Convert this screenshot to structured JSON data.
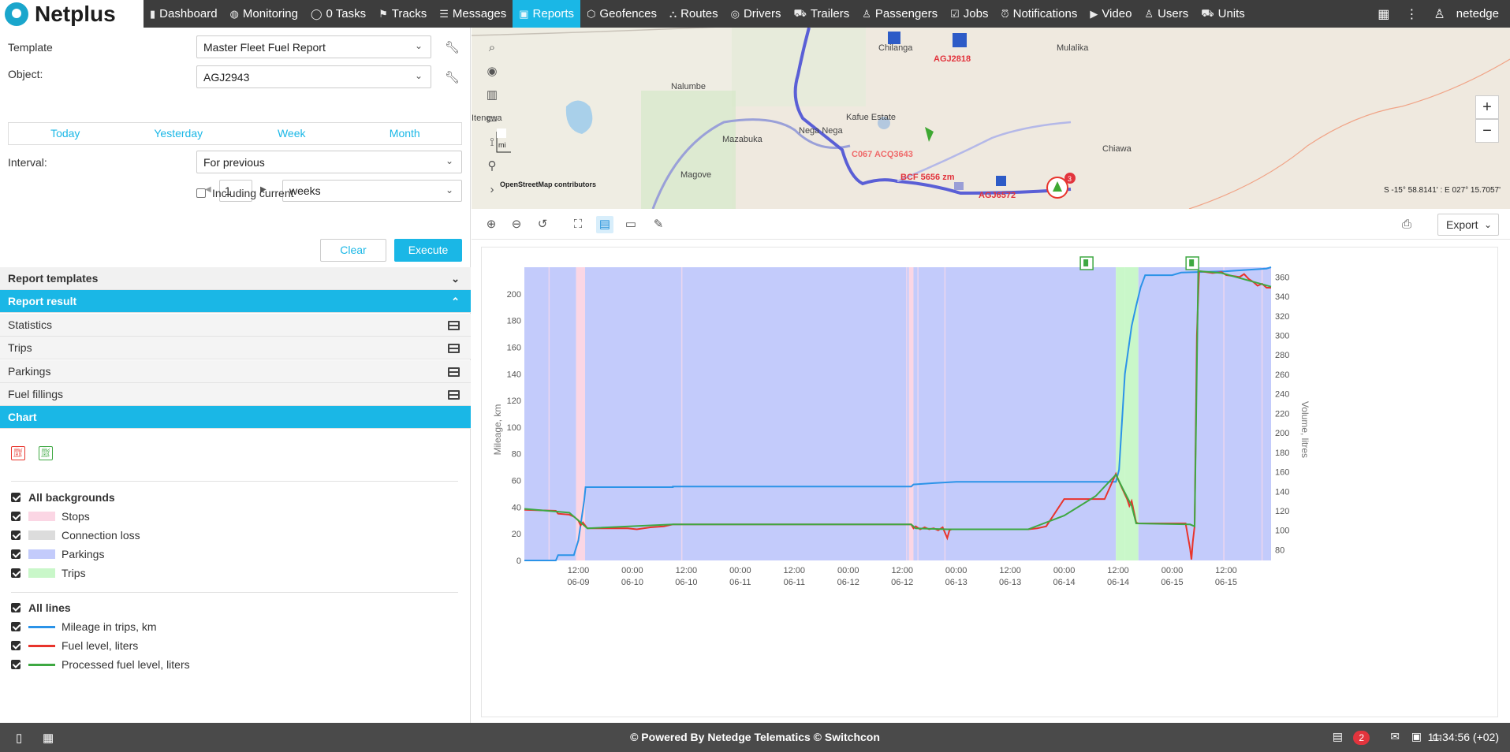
{
  "app": {
    "brand": "Netplus",
    "username": "netedge"
  },
  "nav": [
    {
      "label": "Dashboard",
      "icon": "bar-chart-icon"
    },
    {
      "label": "Monitoring",
      "icon": "globe-icon"
    },
    {
      "label": "0 Tasks",
      "icon": "check-circle-icon"
    },
    {
      "label": "Tracks",
      "icon": "flag-icon"
    },
    {
      "label": "Messages",
      "icon": "list-icon"
    },
    {
      "label": "Reports",
      "icon": "report-icon",
      "active": true
    },
    {
      "label": "Geofences",
      "icon": "geofence-icon"
    },
    {
      "label": "Routes",
      "icon": "route-icon"
    },
    {
      "label": "Drivers",
      "icon": "steering-wheel-icon"
    },
    {
      "label": "Trailers",
      "icon": "trailer-icon"
    },
    {
      "label": "Passengers",
      "icon": "passenger-icon"
    },
    {
      "label": "Jobs",
      "icon": "clipboard-icon"
    },
    {
      "label": "Notifications",
      "icon": "alarm-icon"
    },
    {
      "label": "Video",
      "icon": "video-icon"
    },
    {
      "label": "Users",
      "icon": "user-icon"
    },
    {
      "label": "Units",
      "icon": "car-icon"
    }
  ],
  "form": {
    "template_label": "Template",
    "template_value": "Master Fleet  Fuel Report",
    "object_label": "Object:",
    "object_value": "AGJ2943",
    "quick": [
      "Today",
      "Yesterday",
      "Week",
      "Month"
    ],
    "interval_label": "Interval:",
    "interval_value": "For previous",
    "count_value": "1",
    "unit_value": "weeks",
    "including_current": "Including current",
    "clear_label": "Clear",
    "execute_label": "Execute"
  },
  "sections": {
    "templates": "Report templates",
    "result": "Report result",
    "items": [
      "Statistics",
      "Trips",
      "Parkings",
      "Fuel fillings"
    ],
    "chart": "Chart"
  },
  "legend": {
    "backgrounds_title": "All backgrounds",
    "backgrounds": [
      {
        "label": "Stops",
        "color": "#fbd6e4"
      },
      {
        "label": "Connection loss",
        "color": "#dcdcdc"
      },
      {
        "label": "Parkings",
        "color": "#c3cbfb"
      },
      {
        "label": "Trips",
        "color": "#c9f7c9"
      }
    ],
    "lines_title": "All lines",
    "lines": [
      {
        "label": "Mileage in trips, km",
        "color": "#2b93e8"
      },
      {
        "label": "Fuel level, liters",
        "color": "#e8342c"
      },
      {
        "label": "Processed fuel level, liters",
        "color": "#3ea842"
      }
    ]
  },
  "map": {
    "places": [
      "Chilanga",
      "Mulalika",
      "Nalumbe",
      "Kafue Estate",
      "Nega Nega",
      "Mazabuka",
      "Chiawa",
      "Magove",
      "Itengwa"
    ],
    "units": [
      "AGJ2818",
      "C067 ACQ3643",
      "BCF 5656 zm",
      "AGJ6572"
    ],
    "cluster_count": "3",
    "attribution": "OpenStreetMap contributors",
    "scale_label": "mi",
    "coords": "S -15° 58.8141' : E 027° 15.7057'"
  },
  "toolbar": {
    "export_label": "Export"
  },
  "footer": {
    "powered": "© Powered By Netedge Telematics © Switchcon",
    "time": "11:34:56 (+02)",
    "badge": "2"
  },
  "chart_data": {
    "type": "line",
    "ylabel": "Mileage, km",
    "y2label": "Volume, litres",
    "ylim": [
      0,
      220
    ],
    "y2lim": [
      69,
      370
    ],
    "yticks": [
      0,
      20,
      40,
      60,
      80,
      100,
      120,
      140,
      160,
      180,
      200
    ],
    "y2ticks": [
      80,
      100,
      120,
      140,
      160,
      180,
      200,
      220,
      240,
      260,
      280,
      300,
      320,
      340,
      360
    ],
    "xlim": [
      0,
      166
    ],
    "xticks": [
      {
        "t": 12,
        "time": "12:00",
        "date": "06-09"
      },
      {
        "t": 24,
        "time": "00:00",
        "date": "06-10"
      },
      {
        "t": 36,
        "time": "12:00",
        "date": "06-10"
      },
      {
        "t": 48,
        "time": "00:00",
        "date": "06-11"
      },
      {
        "t": 60,
        "time": "12:00",
        "date": "06-11"
      },
      {
        "t": 72,
        "time": "00:00",
        "date": "06-12"
      },
      {
        "t": 84,
        "time": "12:00",
        "date": "06-12"
      },
      {
        "t": 96,
        "time": "00:00",
        "date": "06-13"
      },
      {
        "t": 108,
        "time": "12:00",
        "date": "06-13"
      },
      {
        "t": 120,
        "time": "00:00",
        "date": "06-14"
      },
      {
        "t": 132,
        "time": "12:00",
        "date": "06-14"
      },
      {
        "t": 144,
        "time": "00:00",
        "date": "06-15"
      },
      {
        "t": 156,
        "time": "12:00",
        "date": "06-15"
      }
    ],
    "backgrounds": [
      {
        "from": 0,
        "to": 11.5,
        "kind": "Parkings"
      },
      {
        "from": 11.5,
        "to": 13.5,
        "kind": "Stops"
      },
      {
        "from": 13.5,
        "to": 85.5,
        "kind": "Parkings"
      },
      {
        "from": 85.5,
        "to": 86.5,
        "kind": "Stops"
      },
      {
        "from": 86.5,
        "to": 131.5,
        "kind": "Parkings"
      },
      {
        "from": 131.5,
        "to": 133.5,
        "kind": "Trips"
      },
      {
        "from": 133.5,
        "to": 136.5,
        "kind": "Trips"
      },
      {
        "from": 136.5,
        "to": 166,
        "kind": "Parkings"
      }
    ],
    "fuel_filling_markers": [
      125,
      148.5
    ],
    "series": [
      {
        "name": "Mileage in trips, km",
        "axis": "left",
        "points": [
          [
            0,
            0
          ],
          [
            7,
            0
          ],
          [
            7.5,
            4
          ],
          [
            11,
            4
          ],
          [
            12,
            15
          ],
          [
            13.3,
            45
          ],
          [
            13.6,
            55
          ],
          [
            33,
            55
          ],
          [
            33,
            55.5
          ],
          [
            86,
            55.5
          ],
          [
            86.5,
            57
          ],
          [
            91,
            58
          ],
          [
            96,
            59
          ],
          [
            131.5,
            59
          ],
          [
            132.2,
            68
          ],
          [
            133.5,
            140
          ],
          [
            135,
            176
          ],
          [
            136,
            191
          ],
          [
            137,
            205
          ],
          [
            138,
            214
          ],
          [
            144,
            214
          ],
          [
            146,
            216
          ],
          [
            156,
            217
          ],
          [
            165,
            219
          ],
          [
            166,
            220
          ]
        ]
      },
      {
        "name": "Fuel level, liters",
        "axis": "right",
        "points": [
          [
            0,
            121
          ],
          [
            7,
            120
          ],
          [
            7.5,
            117
          ],
          [
            10,
            116
          ],
          [
            11,
            114
          ],
          [
            12,
            110
          ],
          [
            12.5,
            105
          ],
          [
            13,
            108
          ],
          [
            14,
            102
          ],
          [
            23,
            102
          ],
          [
            25,
            101
          ],
          [
            28,
            103
          ],
          [
            31,
            104
          ],
          [
            33,
            106
          ],
          [
            86,
            106
          ],
          [
            86.5,
            102
          ],
          [
            87,
            104
          ],
          [
            88,
            101
          ],
          [
            89,
            103
          ],
          [
            90,
            101
          ],
          [
            91,
            102
          ],
          [
            92,
            100
          ],
          [
            93,
            103
          ],
          [
            94,
            92
          ],
          [
            94.5,
            100
          ],
          [
            95,
            101
          ],
          [
            101,
            101
          ],
          [
            112,
            101
          ],
          [
            114,
            102
          ],
          [
            116,
            104
          ],
          [
            120,
            132
          ],
          [
            129,
            132
          ],
          [
            131.5,
            158
          ],
          [
            132.2,
            150
          ],
          [
            133,
            142
          ],
          [
            134,
            132
          ],
          [
            134.5,
            125
          ],
          [
            135,
            130
          ],
          [
            136,
            108
          ],
          [
            136.5,
            107
          ],
          [
            147,
            107
          ],
          [
            148,
            81
          ],
          [
            148.3,
            70
          ],
          [
            148.6,
            88
          ],
          [
            149,
            104
          ],
          [
            149.5,
            300
          ],
          [
            150,
            366
          ],
          [
            153,
            364
          ],
          [
            155,
            365
          ],
          [
            156,
            362
          ],
          [
            159,
            360
          ],
          [
            160,
            363
          ],
          [
            161,
            358
          ],
          [
            162,
            355
          ],
          [
            163,
            351
          ],
          [
            164,
            353
          ],
          [
            165,
            349
          ],
          [
            166,
            349
          ]
        ]
      },
      {
        "name": "Processed fuel level, liters",
        "axis": "right",
        "points": [
          [
            0,
            122
          ],
          [
            10,
            118
          ],
          [
            12,
            110
          ],
          [
            14,
            102
          ],
          [
            33,
            106
          ],
          [
            86,
            106
          ],
          [
            87,
            102
          ],
          [
            94,
            101
          ],
          [
            112,
            101
          ],
          [
            120,
            115
          ],
          [
            127,
            135
          ],
          [
            131.5,
            157
          ],
          [
            133,
            143
          ],
          [
            135,
            125
          ],
          [
            136,
            107
          ],
          [
            148,
            106
          ],
          [
            149,
            104
          ],
          [
            149.8,
            366
          ],
          [
            155,
            364
          ],
          [
            166,
            350
          ]
        ]
      }
    ]
  }
}
